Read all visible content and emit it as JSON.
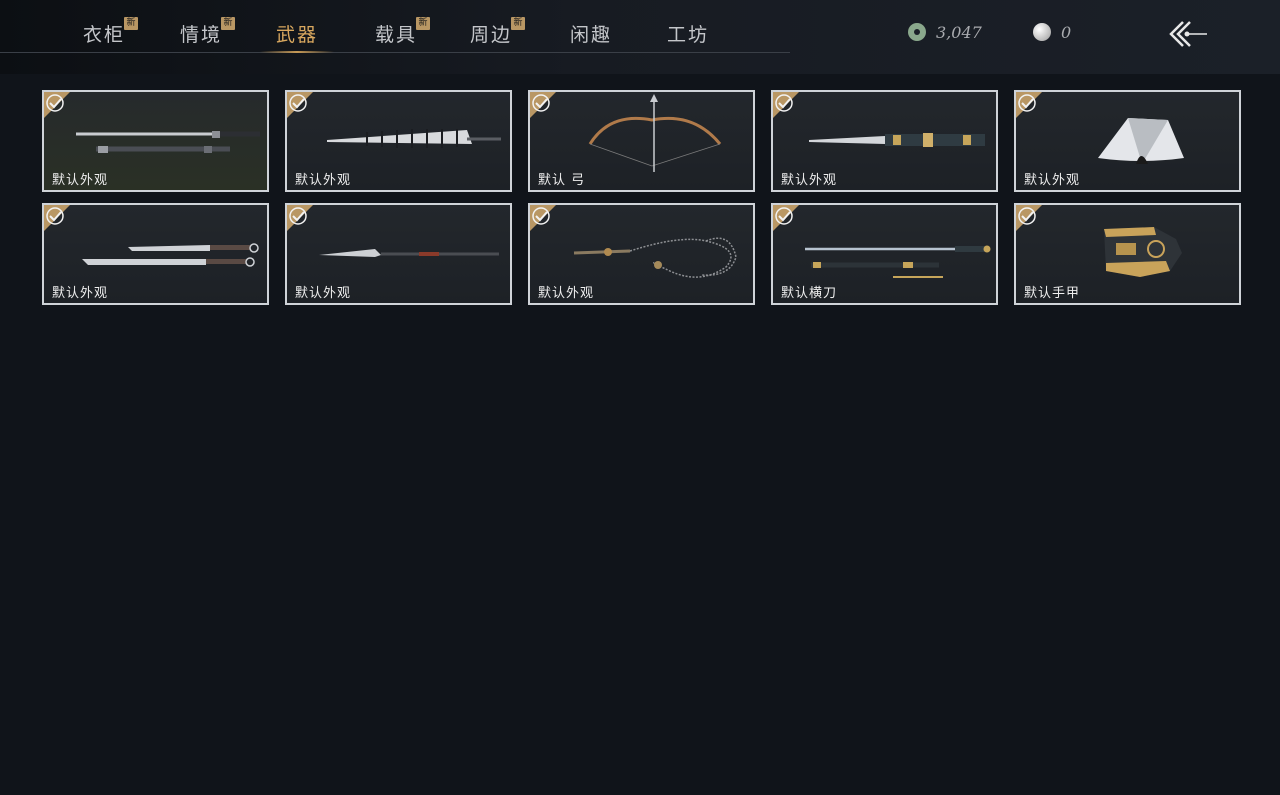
{
  "tabs": [
    {
      "label": "衣柜",
      "badge": "新"
    },
    {
      "label": "情境",
      "badge": "新"
    },
    {
      "label": "武器",
      "badge": ""
    },
    {
      "label": "载具",
      "badge": "新"
    },
    {
      "label": "周边",
      "badge": "新"
    },
    {
      "label": "闲趣",
      "badge": ""
    },
    {
      "label": "工坊",
      "badge": ""
    }
  ],
  "active_tab": "武器",
  "currency": {
    "jade": "3,047",
    "pearl": "0"
  },
  "items": [
    {
      "label": "默认外观",
      "icon": "sword-and-scabbard-icon"
    },
    {
      "label": "默认外观",
      "icon": "umbrella-icon"
    },
    {
      "label": "默认 弓",
      "icon": "bow-icon"
    },
    {
      "label": "默认外观",
      "icon": "ornate-blade-icon"
    },
    {
      "label": "默认外观",
      "icon": "folding-fan-icon"
    },
    {
      "label": "默认外观",
      "icon": "twin-blades-icon"
    },
    {
      "label": "默认外观",
      "icon": "spear-icon"
    },
    {
      "label": "默认外观",
      "icon": "rope-dart-icon"
    },
    {
      "label": "默认横刀",
      "icon": "hengdao-sabre-icon"
    },
    {
      "label": "默认手甲",
      "icon": "gauntlet-icon"
    }
  ],
  "colors": {
    "accent": "#d9a85f",
    "badge": "#b99764",
    "card_border": "#cfd3d8",
    "background": "#10141a"
  }
}
